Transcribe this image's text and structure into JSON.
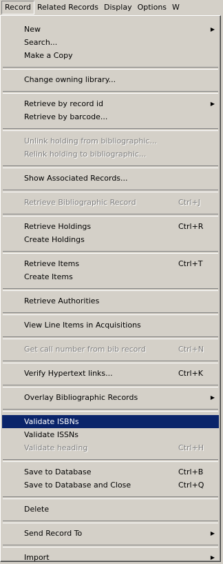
{
  "menubar": {
    "items": [
      "Record",
      "Related Records",
      "Display",
      "Options",
      "W"
    ]
  },
  "menu": {
    "groups": [
      [
        {
          "label": "New",
          "submenu": true
        },
        {
          "label": "Search..."
        },
        {
          "label": "Make a Copy"
        }
      ],
      [
        {
          "label": "Change owning library..."
        }
      ],
      [
        {
          "label": "Retrieve by record id",
          "submenu": true
        },
        {
          "label": "Retrieve by barcode..."
        }
      ],
      [
        {
          "label": "Unlink holding from bibliographic...",
          "disabled": true
        },
        {
          "label": "Relink holding to bibliographic...",
          "disabled": true
        }
      ],
      [
        {
          "label": "Show Associated Records..."
        }
      ],
      [
        {
          "label": "Retrieve Bibliographic Record",
          "shortcut": "Ctrl+J",
          "disabled": true
        }
      ],
      [
        {
          "label": "Retrieve Holdings",
          "shortcut": "Ctrl+R"
        },
        {
          "label": "Create Holdings"
        }
      ],
      [
        {
          "label": "Retrieve Items",
          "shortcut": "Ctrl+T"
        },
        {
          "label": "Create Items"
        }
      ],
      [
        {
          "label": "Retrieve Authorities"
        }
      ],
      [
        {
          "label": "View Line Items in Acquisitions"
        }
      ],
      [
        {
          "label": "Get call number from bib record",
          "shortcut": "Ctrl+N",
          "disabled": true
        }
      ],
      [
        {
          "label": "Verify Hypertext links...",
          "shortcut": "Ctrl+K"
        }
      ],
      [
        {
          "label": "Overlay Bibliographic Records",
          "submenu": true
        }
      ],
      [
        {
          "label": "Validate ISBNs",
          "highlighted": true
        },
        {
          "label": "Validate ISSNs"
        },
        {
          "label": "Validate heading",
          "shortcut": "Ctrl+H",
          "disabled": true
        }
      ],
      [
        {
          "label": "Save to Database",
          "shortcut": "Ctrl+B"
        },
        {
          "label": "Save to Database and Close",
          "shortcut": "Ctrl+Q"
        }
      ],
      [
        {
          "label": "Delete"
        }
      ],
      [
        {
          "label": "Send Record To",
          "submenu": true
        }
      ],
      [
        {
          "label": "Import",
          "submenu": true
        }
      ]
    ]
  },
  "colors": {
    "menu_bg": "#d4d0c8",
    "highlight": "#0a246a",
    "disabled": "#808080"
  },
  "icons": {
    "submenu": "submenu-arrow-icon"
  }
}
